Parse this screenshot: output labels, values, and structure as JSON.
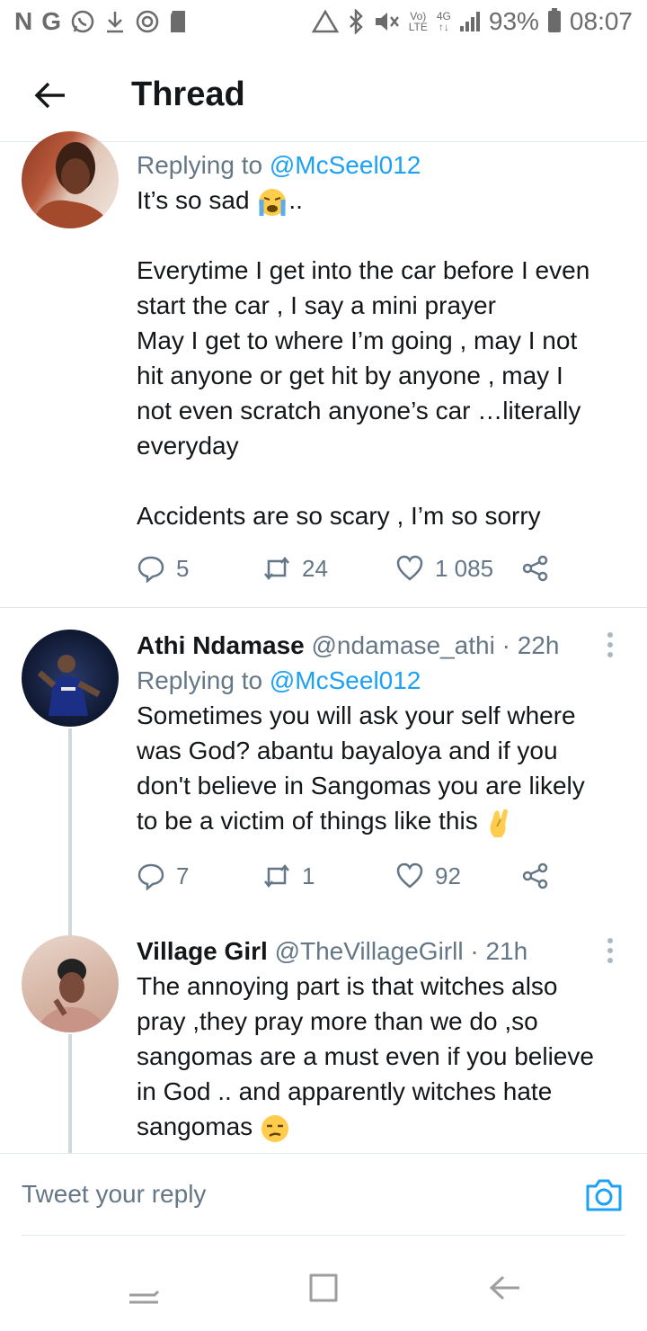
{
  "status_bar": {
    "left_glyphs": [
      "N",
      "G"
    ],
    "left_icons": [
      "whatsapp-icon",
      "download-icon",
      "sync-icon",
      "sd-card-icon"
    ],
    "right_icons": [
      "data-saver-icon",
      "bluetooth-icon",
      "mute-icon",
      "volte-icon",
      "4g-icon",
      "signal-icon",
      "battery-icon"
    ],
    "volte_top": "Vo)",
    "volte_bottom": "LTE",
    "net_top": "4G",
    "net_bottom": "↑↓",
    "battery": "93%",
    "time": "08:07"
  },
  "header": {
    "title": "Thread",
    "back_icon": "arrow-left-icon"
  },
  "tweets": [
    {
      "replying_prefix": "Replying to ",
      "replying_handle": "@McSeel012",
      "lines": [
        "It’s so sad",
        "..",
        "Everytime I get into the car before I even",
        "start the car , I say a mini prayer",
        "May I get to where I’m going , may I not",
        "hit anyone or get hit by anyone , may I",
        "not even scratch anyone’s car  …literally",
        "everyday",
        "Accidents are so scary , I’m so sorry"
      ],
      "emoji": "crying-face-emoji",
      "replies": "5",
      "retweets": "24",
      "likes": "1 085"
    },
    {
      "name": "Athi Ndamase",
      "handle": "@ndamase_athi",
      "time": "· 22h",
      "replying_prefix": "Replying to ",
      "replying_handle": "@McSeel012",
      "lines": [
        "Sometimes you will ask your self where",
        "was God? abantu bayaloya and if you",
        "don't believe in Sangomas you are likely",
        "to be a victim of things like this"
      ],
      "emoji": "crossed-fingers-emoji",
      "replies": "7",
      "retweets": "1",
      "likes": "92"
    },
    {
      "name": "Village Girl",
      "handle": "@TheVillageGirll",
      "time": "· 21h",
      "lines": [
        "The annoying part is that witches also",
        "pray ,they pray more than we do ,so",
        "sangomas  are a must even if you believe",
        "in God .. and apparently witches hate",
        "sangomas"
      ],
      "emoji": "unamused-face-emoji"
    }
  ],
  "reply_bar": {
    "placeholder": "Tweet your reply",
    "icon": "camera-icon"
  },
  "nav_bar": {
    "icons": [
      "recent-apps-icon",
      "home-icon",
      "back-icon"
    ]
  },
  "colors": {
    "link": "#1da1f2",
    "secondary_text": "#657786",
    "divider": "#e1e8ed"
  }
}
